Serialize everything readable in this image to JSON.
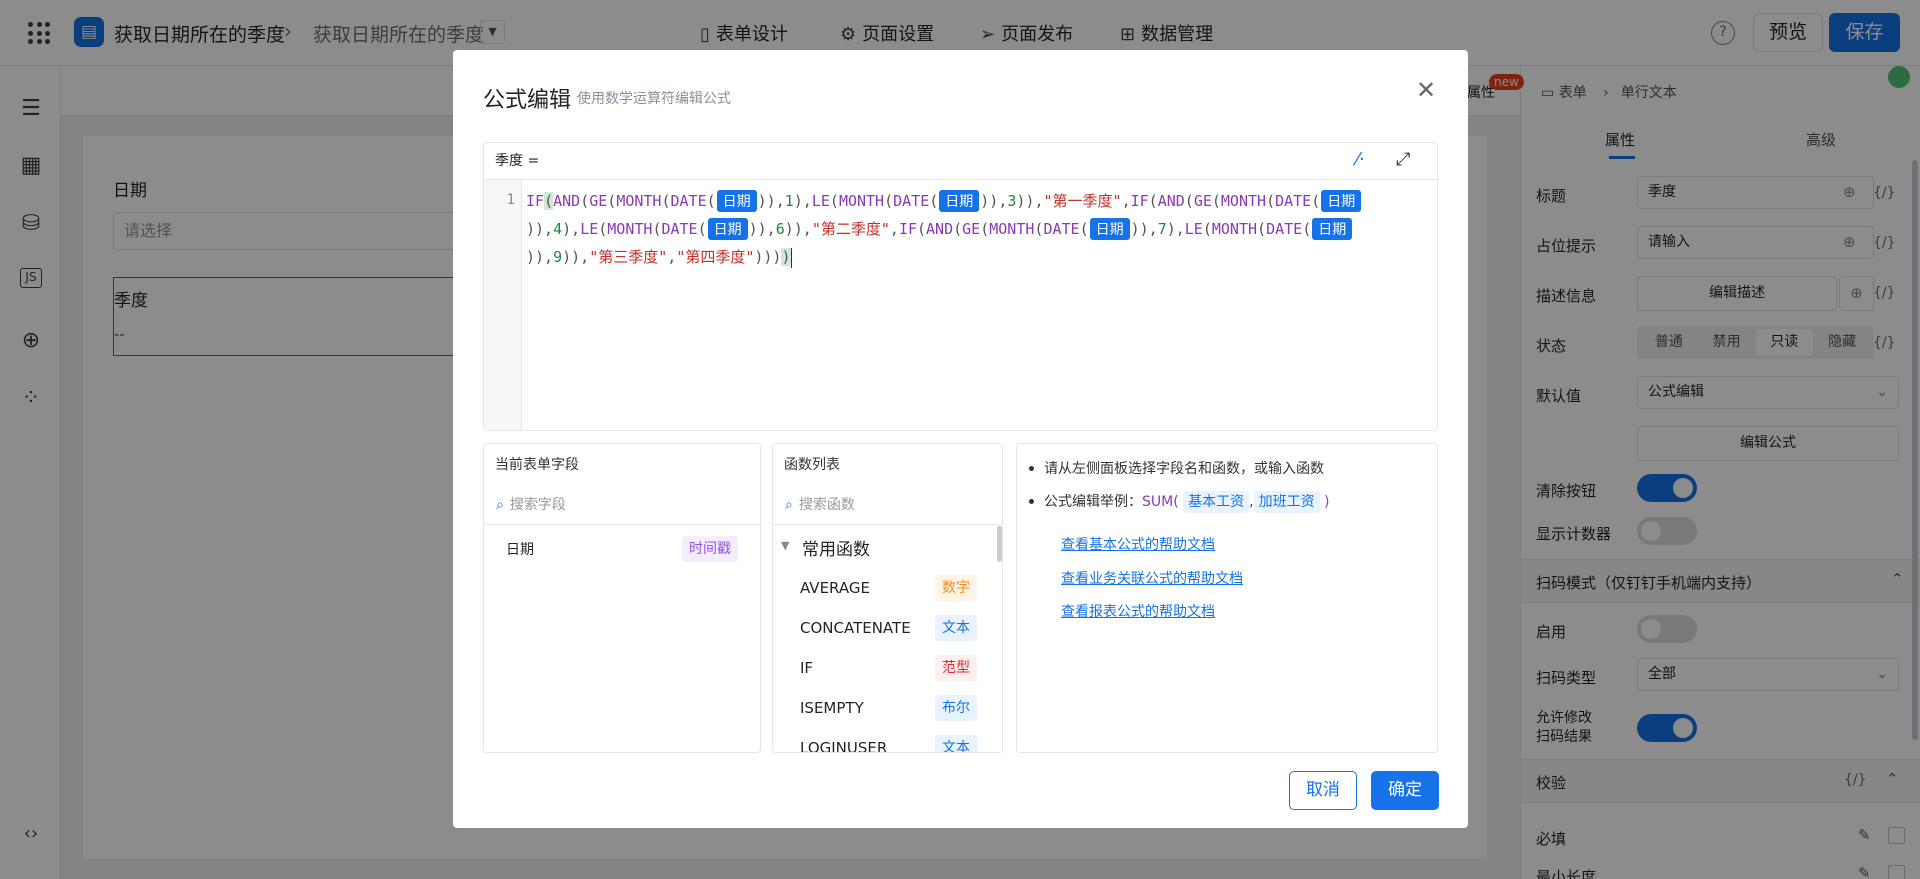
{
  "header": {
    "app_icon": "form-doc-icon",
    "crumb_app": "获取日期所在的季度",
    "crumb_page": "获取日期所在的季度",
    "nav": [
      {
        "label": "表单设计",
        "icon": "doc-icon"
      },
      {
        "label": "页面设置",
        "icon": "gear-icon"
      },
      {
        "label": "页面发布",
        "icon": "send-icon"
      },
      {
        "label": "数据管理",
        "icon": "table-icon"
      }
    ],
    "help_icon": "question-icon",
    "preview_label": "预览",
    "save_label": "保存"
  },
  "canvas": {
    "date_label": "日期",
    "date_placeholder": "请选择",
    "quarter_label": "季度",
    "quarter_value": "--"
  },
  "right_panel": {
    "tab_props": "属性",
    "new_badge": "new",
    "breadcrumb_form": "表单",
    "breadcrumb_field": "单行文本",
    "tab_basic": "属性",
    "tab_advanced": "高级",
    "title_label": "标题",
    "title_value": "季度",
    "placeholder_label": "占位提示",
    "placeholder_value": "请输入",
    "desc_label": "描述信息",
    "desc_button": "编辑描述",
    "state_label": "状态",
    "state_options": [
      "普通",
      "禁用",
      "只读",
      "隐藏"
    ],
    "state_selected": "只读",
    "default_label": "默认值",
    "default_value": "公式编辑",
    "edit_formula_button": "编辑公式",
    "clear_button_label": "清除按钮",
    "counter_label": "显示计数器",
    "scan_section": "扫码模式（仅钉钉手机端内支持）",
    "scan_enable_label": "启用",
    "scan_type_label": "扫码类型",
    "scan_type_value": "全部",
    "allow_edit_label_1": "允许修改",
    "allow_edit_label_2": "扫码结果",
    "validate_section": "校验",
    "fx_label": "{/}",
    "required_label": "必填",
    "min_length_label": "最小长度"
  },
  "modal": {
    "title": "公式编辑",
    "subtitle": "使用数学运算符编辑公式",
    "editor_label": "季度 =",
    "line_number": "1",
    "field_token": "日期",
    "quarter_1": "\"第一季度\"",
    "quarter_2": "\"第二季度\"",
    "quarter_3": "\"第三季度\"",
    "quarter_4": "\"第四季度\"",
    "fields_pane": {
      "title": "当前表单字段",
      "search_placeholder": "搜索字段",
      "items": [
        {
          "name": "日期",
          "type": "时间戳"
        }
      ]
    },
    "functions_pane": {
      "title": "函数列表",
      "search_placeholder": "搜索函数",
      "group": "常用函数",
      "items": [
        {
          "name": "AVERAGE",
          "type": "数字",
          "color": "#fa8c16"
        },
        {
          "name": "CONCATENATE",
          "type": "文本",
          "color": "#1572e8"
        },
        {
          "name": "IF",
          "type": "范型",
          "color": "#f5222d"
        },
        {
          "name": "ISEMPTY",
          "type": "布尔",
          "color": "#1572e8"
        },
        {
          "name": "LOGINUSER",
          "type": "文本",
          "color": "#1572e8"
        }
      ]
    },
    "help_pane": {
      "line1": "请从左侧面板选择字段名和函数，或输入函数",
      "line2_prefix": "公式编辑举例：",
      "line2_fn": "SUM(",
      "line2_arg1": "基本工资",
      "line2_comma": ",",
      "line2_arg2": "加班工资",
      "line2_end": ")",
      "link1": "查看基本公式的帮助文档",
      "link2": "查看业务关联公式的帮助文档",
      "link3": "查看报表公式的帮助文档"
    },
    "cancel_label": "取消",
    "ok_label": "确定"
  }
}
